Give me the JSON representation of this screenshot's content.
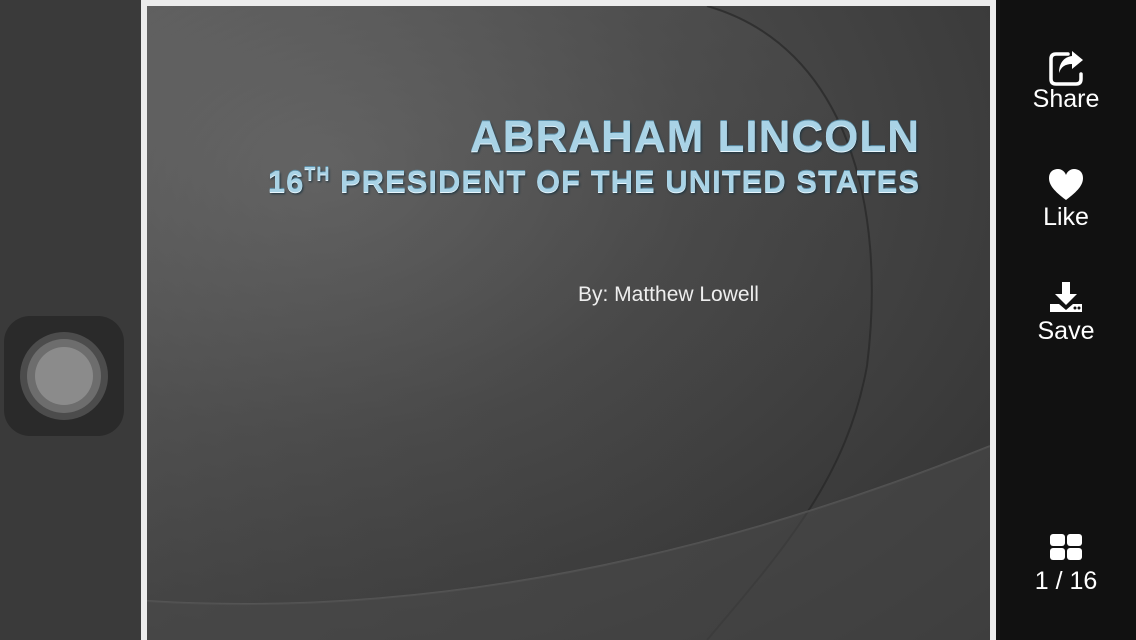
{
  "slide": {
    "title_main": "ABRAHAM LINCOLN",
    "title_sub_num": "16",
    "title_sub_sup": "TH",
    "title_sub_rest": " PRESIDENT OF THE UNITED STATES",
    "author": "By: Matthew Lowell"
  },
  "actions": {
    "share": {
      "label": "Share",
      "icon": "share-icon"
    },
    "like": {
      "label": "Like",
      "icon": "heart-icon"
    },
    "save": {
      "label": "Save",
      "icon": "download-icon"
    }
  },
  "pager": {
    "icon": "grid-icon",
    "text": "1 / 16"
  },
  "colors": {
    "title": "#a9d3e6",
    "panel": "#111111",
    "frame": "#ececec"
  }
}
